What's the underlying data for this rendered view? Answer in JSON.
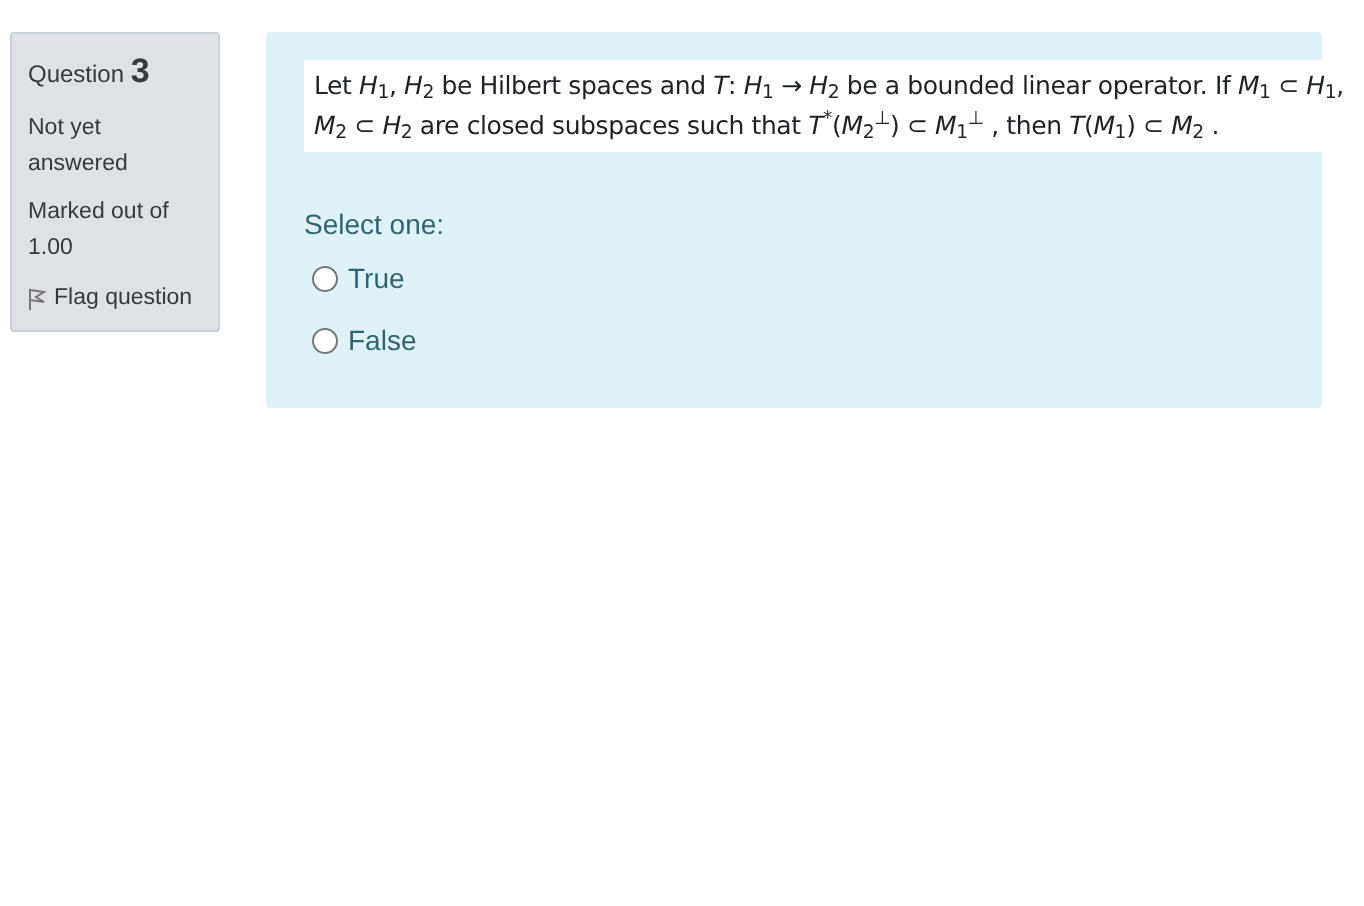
{
  "info": {
    "question_label": "Question",
    "question_number": "3",
    "state": "Not yet answered",
    "marks": "Marked out of 1.00",
    "flag": {
      "label": "Flag question",
      "flagged": false
    }
  },
  "question": {
    "text": "Let *H*$_{1}$, *H*$_{2}$ be Hilbert spaces and *T*: *H*$_{1}$ → *H*$_{2}$ be a bounded linear operator. If  *M*$_{1}$ ⊂ *H*$_{1}$, *M*$_{2}$ ⊂ *H*$_{2}$  are closed subspaces such that  *T*$^{*}$(*M*$_{2}$$^{⊥}$) ⊂  *M*$_{1}$$^{⊥}$ , then  *T*(*M*$_{1}$) ⊂ *M*$_{2}$ .",
    "prompt": "Select one:",
    "options": [
      {
        "label": "True",
        "selected": false
      },
      {
        "label": "False",
        "selected": false
      }
    ]
  }
}
